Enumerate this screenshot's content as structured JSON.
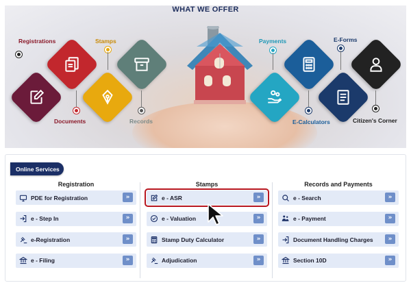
{
  "banner": {
    "title": "WHAT WE OFFER",
    "left_items": [
      {
        "label": "Registrations",
        "icon": "copy-documents-icon",
        "color": "#c2272d"
      },
      {
        "label": "Documents",
        "icon": "edit-document-icon",
        "color": "#6b1b3a"
      },
      {
        "label": "Stamps",
        "icon": "pen-nib-icon",
        "color": "#e8a90e"
      },
      {
        "label": "Records",
        "icon": "archive-box-icon",
        "color": "#5f7f79"
      }
    ],
    "right_items": [
      {
        "label": "Payments",
        "icon": "hand-coins-icon",
        "color": "#24a6c3"
      },
      {
        "label": "E-Calculators",
        "icon": "calculator-icon",
        "color": "#1b5e9a"
      },
      {
        "label": "E-Forms",
        "icon": "form-list-icon",
        "color": "#1b3a6b"
      },
      {
        "label": "Citizen's Corner",
        "icon": "user-icon",
        "color": "#222222"
      }
    ]
  },
  "services": {
    "badge": "Online Services",
    "columns": [
      {
        "title": "Registration",
        "items": [
          {
            "label": "PDE for Registration",
            "icon": "monitor-icon"
          },
          {
            "label": "e - Step In",
            "icon": "sign-in-icon"
          },
          {
            "label": "e-Registration",
            "icon": "gavel-icon"
          },
          {
            "label": "e - Filing",
            "icon": "bank-icon"
          }
        ]
      },
      {
        "title": "Stamps",
        "items": [
          {
            "label": "e - ASR",
            "icon": "edit-icon",
            "highlighted": true
          },
          {
            "label": "e - Valuation",
            "icon": "check-circle-icon"
          },
          {
            "label": "Stamp Duty Calculator",
            "icon": "calculator-icon"
          },
          {
            "label": "Adjudication",
            "icon": "gavel-icon"
          }
        ]
      },
      {
        "title": "Records and Payments",
        "items": [
          {
            "label": "e - Search",
            "icon": "search-icon"
          },
          {
            "label": "e - Payment",
            "icon": "people-money-icon"
          },
          {
            "label": "Document Handling Charges",
            "icon": "sign-in-icon"
          },
          {
            "label": "Section 10D",
            "icon": "bank-icon"
          }
        ]
      }
    ],
    "go_symbol": "»"
  },
  "colors": {
    "navy": "#1b2f66",
    "button_row": "#e3eaf7",
    "go_button": "#6f8fc9",
    "highlight": "#b8161f"
  }
}
